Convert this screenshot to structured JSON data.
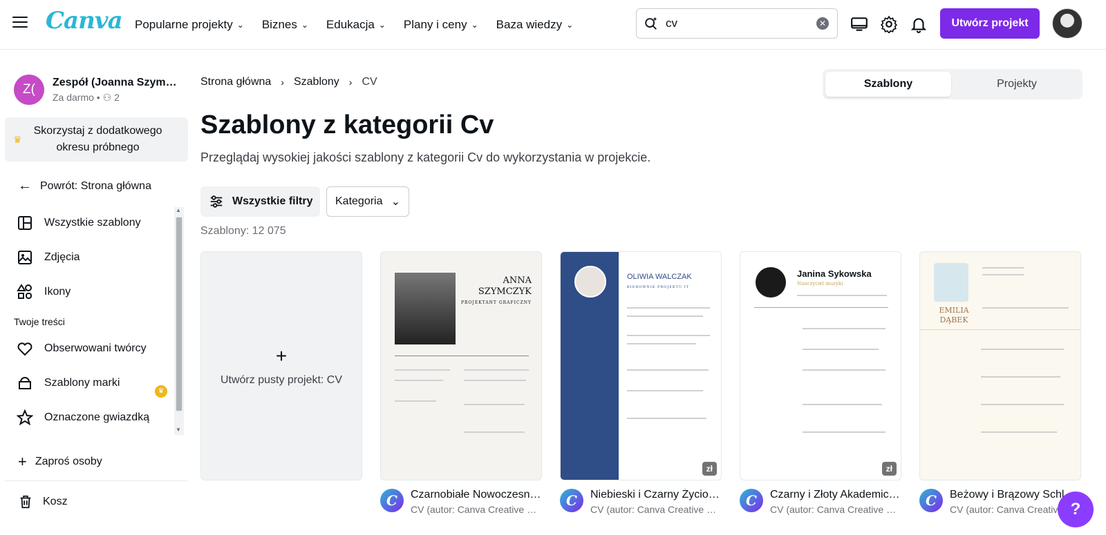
{
  "header": {
    "logo": "Canva",
    "nav": [
      "Popularne projekty",
      "Biznes",
      "Edukacja",
      "Plany i ceny",
      "Baza wiedzy"
    ],
    "search_value": "cv",
    "create_button": "Utwórz projekt"
  },
  "sidebar": {
    "team_initials": "Z(",
    "team_name": "Zespół (Joanna Szymańska)",
    "team_plan": "Za darmo",
    "team_members": "2",
    "trial": "Skorzystaj z dodatkowego okresu próbnego",
    "back": "Powrót: Strona główna",
    "items": [
      {
        "label": "Wszystkie szablony"
      },
      {
        "label": "Zdjęcia"
      },
      {
        "label": "Ikony"
      }
    ],
    "section_heading": "Twoje treści",
    "content_items": [
      {
        "label": "Obserwowani twórcy"
      },
      {
        "label": "Szablony marki"
      },
      {
        "label": "Oznaczone gwiazdką"
      }
    ],
    "invite": "Zaproś osoby",
    "trash": "Kosz"
  },
  "main": {
    "breadcrumb": [
      "Strona główna",
      "Szablony",
      "CV"
    ],
    "tabs": [
      "Szablony",
      "Projekty"
    ],
    "title": "Szablony z kategorii Cv",
    "subtitle": "Przeglądaj wysokiej jakości szablony z kategorii Cv do wykorzystania w projekcie.",
    "filters_button": "Wszystkie filtry",
    "category_button": "Kategoria",
    "count": "Szablony: 12 075",
    "empty_card": "Utwórz pusty projekt: CV",
    "templates": [
      {
        "title": "Czarnobiałe Nowoczesne CV",
        "author": "CV (autor: Canva Creative Studio)",
        "name": "ANNA SZYMCZYK",
        "role": "PROJEKTANT GRAFICZNY",
        "price": ""
      },
      {
        "title": "Niebieski i Czarny Życiorys",
        "author": "CV (autor: Canva Creative Studio)",
        "name": "OLIWIA WALCZAK",
        "role": "KIEROWNIK PROJEKTU IT",
        "price": "zł"
      },
      {
        "title": "Czarny i Złoty Akademicki CV",
        "author": "CV (autor: Canva Creative Studio)",
        "name": "Janina Sykowska",
        "role": "Nauczyciel muzyki",
        "price": "zł"
      },
      {
        "title": "Beżowy i Brązowy Schludny CV",
        "author": "CV (autor: Canva Creative Studio)",
        "name": "EMILIA DĄBEK",
        "role": "",
        "price": ""
      }
    ]
  },
  "help": "?"
}
